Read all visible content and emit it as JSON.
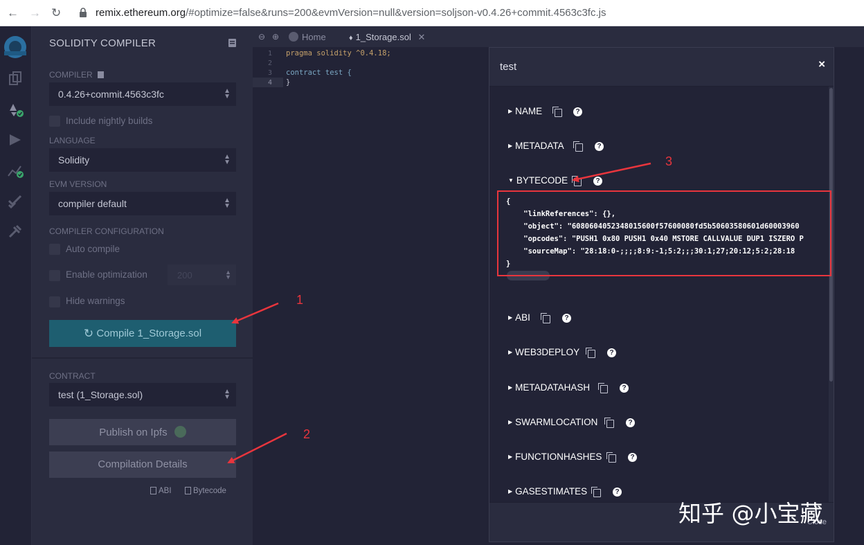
{
  "browser": {
    "url_host": "remix.ethereum.org",
    "url_rest": "/#optimize=false&runs=200&evmVersion=null&version=soljson-v0.4.26+commit.4563c3fc.js"
  },
  "sidebar": {
    "title": "SOLIDITY COMPILER",
    "compiler_label": "COMPILER",
    "compiler_value": "0.4.26+commit.4563c3fc",
    "nightly_label": "Include nightly builds",
    "language_label": "LANGUAGE",
    "language_value": "Solidity",
    "evm_label": "EVM VERSION",
    "evm_value": "compiler default",
    "config_label": "COMPILER CONFIGURATION",
    "auto_compile": "Auto compile",
    "enable_optimization": "Enable optimization",
    "runs_value": "200",
    "hide_warnings": "Hide warnings",
    "compile_button": "Compile 1_Storage.sol",
    "contract_label": "CONTRACT",
    "contract_value": "test (1_Storage.sol)",
    "publish_button": "Publish on Ipfs",
    "details_button": "Compilation Details",
    "abi_link": "ABI",
    "bytecode_link": "Bytecode"
  },
  "editor": {
    "home_tab": "Home",
    "file_tab": "1_Storage.sol",
    "line_numbers": [
      "1",
      "2",
      "3",
      "4"
    ],
    "code_lines": [
      "pragma solidity ^0.4.18;",
      "",
      "contract test {",
      "}"
    ]
  },
  "modal": {
    "title": "test",
    "close_x": "×",
    "sections": [
      "NAME",
      "METADATA",
      "BYTECODE",
      "ABI",
      "WEB3DEPLOY",
      "METADATAHASH",
      "SWARMLOCATION",
      "FUNCTIONHASHES",
      "GASESTIMATES"
    ],
    "bytecode_lines": [
      "{",
      "    \"linkReferences\": {},",
      "    \"object\": \"6080604052348015600f57600080fd5b50603580601d60003960",
      "    \"opcodes\": \"PUSH1 0x80 PUSH1 0x40 MSTORE CALLVALUE DUP1 ISZERO P",
      "    \"sourceMap\": \"28:18:0-;;;;8:9:-1;5:2;;;30:1;27;20:12;5:2;28:18",
      "}"
    ],
    "footer_close": "Close"
  },
  "annotations": [
    "1",
    "2",
    "3"
  ],
  "watermark": "知乎 @小宝藏",
  "colors": {
    "arrow_red": "#e8353d",
    "compile_btn": "#1e5e70",
    "panel_bg": "#2a2c3f",
    "editor_bg": "#222336"
  }
}
